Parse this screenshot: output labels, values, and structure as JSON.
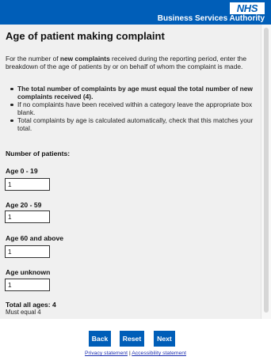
{
  "header": {
    "logo_text": "NHS",
    "org_name": "Business Services Authority",
    "brand_color": "#005eb8"
  },
  "page": {
    "title": "Age of patient making complaint",
    "intro_before": "For the number of ",
    "intro_bold": "new complaints",
    "intro_after": " received during the reporting period, enter the breakdown of  the age of patients by or on behalf of whom the complaint is made.",
    "rules": [
      "The total number of complaints by age must equal the total number of new complaints received (4).",
      "If no complaints have been received within a category leave the appropriate box blank.",
      "Total complaints by age is calculated automatically, check that this matches your total."
    ]
  },
  "form": {
    "section_label": "Number of patients:",
    "fields": [
      {
        "label": "Age 0 - 19",
        "value": "1"
      },
      {
        "label": "Age 20 - 59",
        "value": "1"
      },
      {
        "label": "Age 60 and above",
        "value": "1"
      },
      {
        "label": "Age unknown",
        "value": "1"
      }
    ],
    "total_label": "Total all ages: 4",
    "must_equal": "Must equal 4"
  },
  "buttons": {
    "back": "Back",
    "reset": "Reset",
    "next": "Next"
  },
  "footer": {
    "privacy": "Privacy statement",
    "separator": "|",
    "accessibility": "Accessibility statement"
  }
}
